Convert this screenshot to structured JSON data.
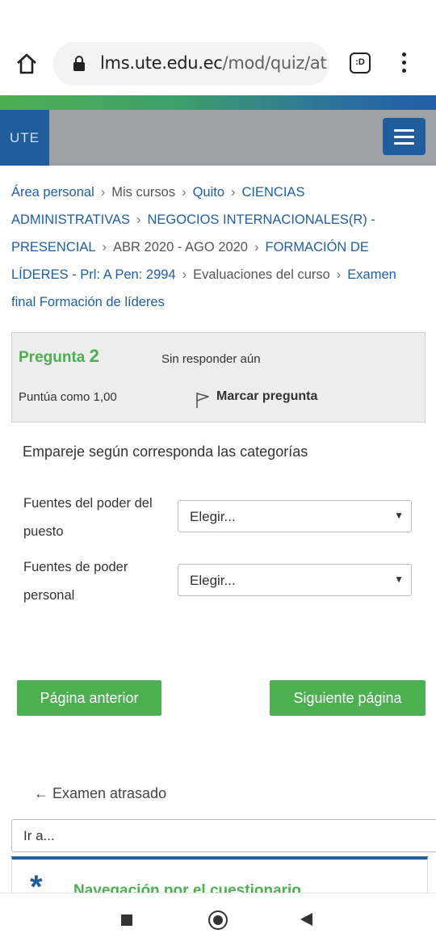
{
  "browser": {
    "url_host": "lms.ute.edu.ec",
    "url_path": "/mod/quiz/at",
    "tab_icon_label": ":D"
  },
  "header": {
    "brand": "UTE"
  },
  "breadcrumb": [
    {
      "label": "Área personal",
      "link": true
    },
    {
      "label": "Mis cursos",
      "link": false
    },
    {
      "label": "Quito",
      "link": true
    },
    {
      "label": "CIENCIAS ADMINISTRATIVAS",
      "link": true
    },
    {
      "label": "NEGOCIOS INTERNACIONALES(R) - PRESENCIAL",
      "link": true
    },
    {
      "label": "ABR 2020 - AGO 2020",
      "link": false
    },
    {
      "label": "FORMACIÓN DE LÍDERES - Prl: A Pen: 2994",
      "link": true
    },
    {
      "label": "Evaluaciones del curso",
      "link": false
    },
    {
      "label": "Examen final Formación de líderes",
      "link": true
    }
  ],
  "question": {
    "label": "Pregunta",
    "number": "2",
    "state": "Sin responder aún",
    "grade": "Puntúa como 1,00",
    "flag_label": "Marcar pregunta",
    "text": "Empareje según corresponda las categorías",
    "matches": [
      {
        "label": "Fuentes del poder del puesto",
        "selected": "Elegir..."
      },
      {
        "label": "Fuentes de poder personal",
        "selected": "Elegir..."
      }
    ]
  },
  "buttons": {
    "prev": "Página anterior",
    "next": "Siguiente página"
  },
  "footer": {
    "back_link": "← Examen atrasado",
    "goto_placeholder": "Ir a...",
    "nav_block_title": "Navegación por el cuestionario"
  },
  "colors": {
    "primary": "#1f5d9c",
    "success": "#4caf50",
    "link": "#1d5fa6"
  }
}
